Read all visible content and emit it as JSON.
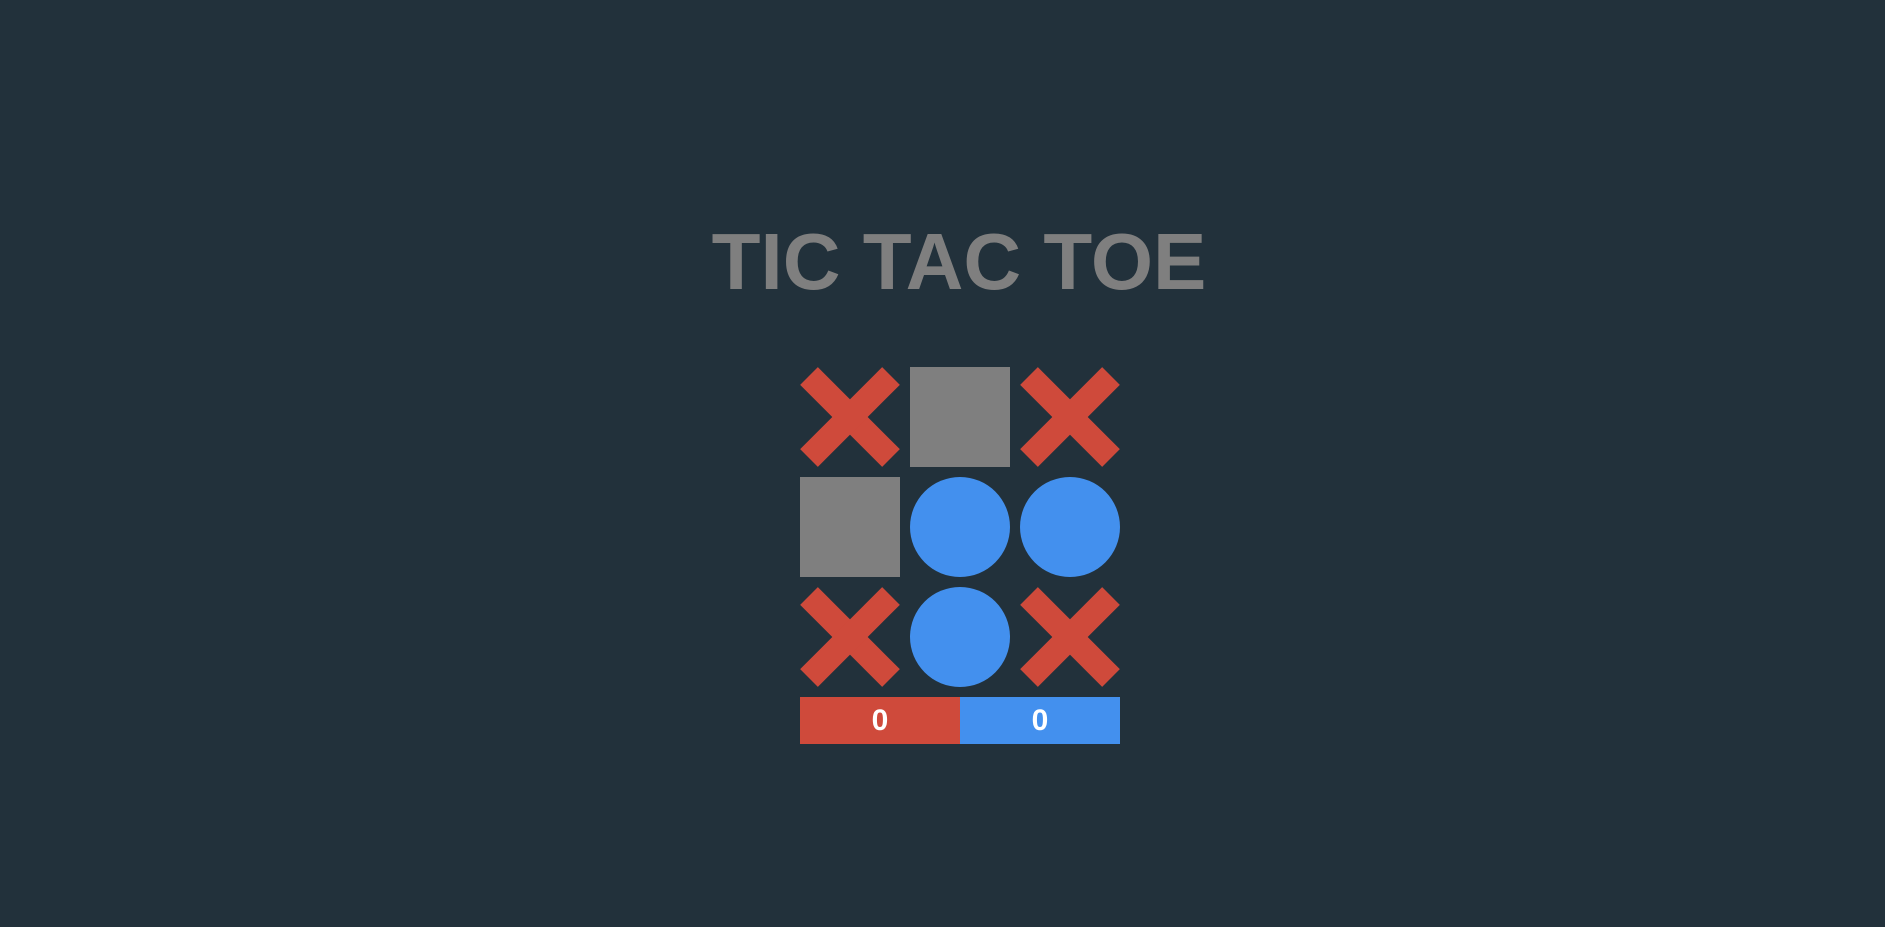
{
  "title": "TIC TAC TOE",
  "colors": {
    "background": "#22313b",
    "x": "#cf4a3b",
    "o": "#4390ee",
    "empty": "#7f7f7f"
  },
  "board": {
    "cells": [
      {
        "state": "x",
        "icon": "x-mark-icon"
      },
      {
        "state": "empty",
        "icon": "empty-square"
      },
      {
        "state": "x",
        "icon": "x-mark-icon"
      },
      {
        "state": "empty",
        "icon": "empty-square"
      },
      {
        "state": "o",
        "icon": "o-circle-icon"
      },
      {
        "state": "o",
        "icon": "o-circle-icon"
      },
      {
        "state": "x",
        "icon": "x-mark-icon"
      },
      {
        "state": "o",
        "icon": "o-circle-icon"
      },
      {
        "state": "x",
        "icon": "x-mark-icon"
      }
    ]
  },
  "scores": {
    "x": "0",
    "o": "0"
  }
}
